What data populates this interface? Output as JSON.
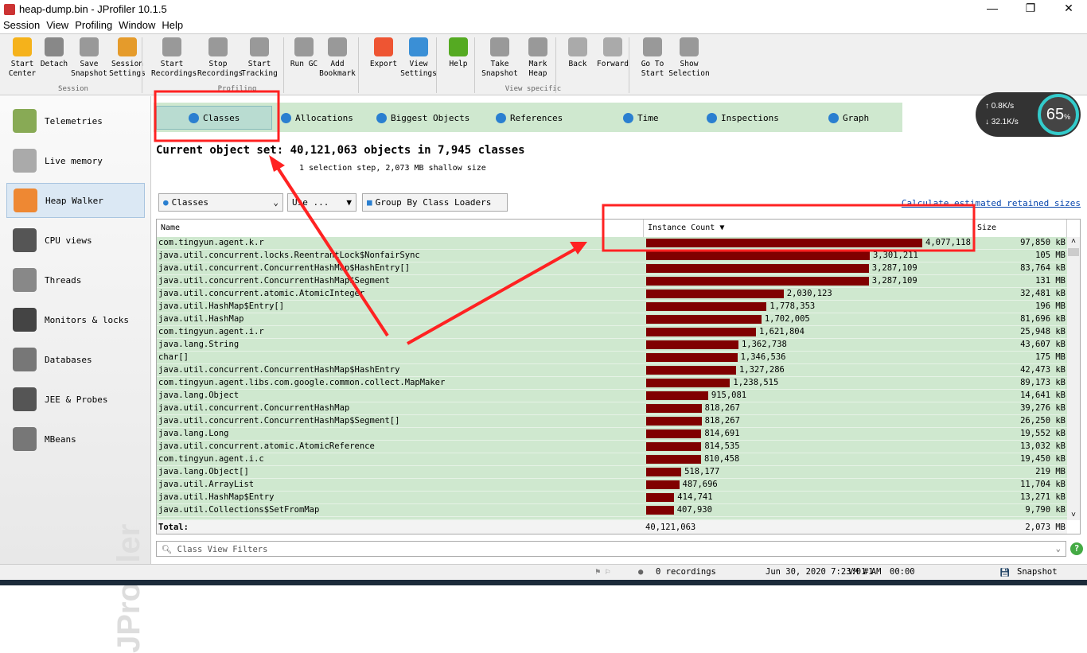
{
  "window": {
    "title": "heap-dump.bin - JProfiler 10.1.5"
  },
  "menu": [
    "Session",
    "View",
    "Profiling",
    "Window",
    "Help"
  ],
  "toolbar": {
    "buttons": [
      [
        "Start",
        "Center"
      ],
      [
        "Detach",
        ""
      ],
      [
        "Save",
        "Snapshot"
      ],
      [
        "Session",
        "Settings"
      ],
      [
        "Start",
        "Recordings"
      ],
      [
        "Stop",
        "Recordings"
      ],
      [
        "Start",
        "Tracking"
      ],
      [
        "Run GC",
        ""
      ],
      [
        "Add",
        "Bookmark"
      ],
      [
        "Export",
        ""
      ],
      [
        "View",
        "Settings"
      ],
      [
        "Help",
        ""
      ],
      [
        "Take",
        "Snapshot"
      ],
      [
        "Mark",
        "Heap"
      ],
      [
        "Back",
        ""
      ],
      [
        "Forward",
        ""
      ],
      [
        "Go To",
        "Start"
      ],
      [
        "Show",
        "Selection"
      ]
    ],
    "groups": [
      "Session",
      "Profiling",
      "View specific"
    ]
  },
  "sidebar": {
    "items": [
      "Telemetries",
      "Live memory",
      "Heap Walker",
      "CPU views",
      "Threads",
      "Monitors & locks",
      "Databases",
      "JEE & Probes",
      "MBeans"
    ],
    "watermark": "JProfiler"
  },
  "tabs": [
    "Classes",
    "Allocations",
    "Biggest Objects",
    "References",
    "Time",
    "Inspections",
    "Graph"
  ],
  "heading": "Current object set: 40,121,063 objects in 7,945 classes",
  "subheading": "1 selection step, 2,073 MB shallow size",
  "controls": {
    "view": "Classes",
    "use": "Use ...",
    "group": "Group By Class Loaders",
    "link": "Calculate estimated retained sizes"
  },
  "table": {
    "headers": [
      "Name",
      "Instance Count",
      "Size"
    ],
    "max_count": 4077118,
    "rows": [
      [
        "com.tingyun.agent.k.r",
        "4,077,118",
        "97,850 kB",
        4077118
      ],
      [
        "java.util.concurrent.locks.ReentrantLock$NonfairSync",
        "3,301,211",
        "105 MB",
        3301211
      ],
      [
        "java.util.concurrent.ConcurrentHashMap$HashEntry[]",
        "3,287,109",
        "83,764 kB",
        3287109
      ],
      [
        "java.util.concurrent.ConcurrentHashMap$Segment",
        "3,287,109",
        "131 MB",
        3287109
      ],
      [
        "java.util.concurrent.atomic.AtomicInteger",
        "2,030,123",
        "32,481 kB",
        2030123
      ],
      [
        "java.util.HashMap$Entry[]",
        "1,778,353",
        "196 MB",
        1778353
      ],
      [
        "java.util.HashMap",
        "1,702,005",
        "81,696 kB",
        1702005
      ],
      [
        "com.tingyun.agent.i.r",
        "1,621,804",
        "25,948 kB",
        1621804
      ],
      [
        "java.lang.String",
        "1,362,738",
        "43,607 kB",
        1362738
      ],
      [
        "char[]",
        "1,346,536",
        "175 MB",
        1346536
      ],
      [
        "java.util.concurrent.ConcurrentHashMap$HashEntry",
        "1,327,286",
        "42,473 kB",
        1327286
      ],
      [
        "com.tingyun.agent.libs.com.google.common.collect.MapMaker",
        "1,238,515",
        "89,173 kB",
        1238515
      ],
      [
        "java.lang.Object",
        "915,081",
        "14,641 kB",
        915081
      ],
      [
        "java.util.concurrent.ConcurrentHashMap",
        "818,267",
        "39,276 kB",
        818267
      ],
      [
        "java.util.concurrent.ConcurrentHashMap$Segment[]",
        "818,267",
        "26,250 kB",
        818267
      ],
      [
        "java.lang.Long",
        "814,691",
        "19,552 kB",
        814691
      ],
      [
        "java.util.concurrent.atomic.AtomicReference",
        "814,535",
        "13,032 kB",
        814535
      ],
      [
        "com.tingyun.agent.i.c",
        "810,458",
        "19,450 kB",
        810458
      ],
      [
        "java.lang.Object[]",
        "518,177",
        "219 MB",
        518177
      ],
      [
        "java.util.ArrayList",
        "487,696",
        "11,704 kB",
        487696
      ],
      [
        "java.util.HashMap$Entry",
        "414,741",
        "13,271 kB",
        414741
      ],
      [
        "java.util.Collections$SetFromMap",
        "407,930",
        "9,790 kB",
        407930
      ]
    ],
    "total": {
      "label": "Total:",
      "count": "40,121,063",
      "size": "2,073 MB"
    }
  },
  "filter": {
    "placeholder": "Class View Filters"
  },
  "status": {
    "recordings": "0 recordings",
    "datetime": "Jun 30, 2020 7:23:01 AM",
    "vm": "VM #1",
    "time": "00:00",
    "mode": "Snapshot"
  },
  "net": {
    "up": "0.8",
    "down": "32.1",
    "unit": "K/s",
    "percent": "65",
    "pct_sign": "%"
  },
  "colors": {
    "row_bg": "#cfe8cf",
    "bar": "#800000",
    "annotation": "#ff2222"
  }
}
